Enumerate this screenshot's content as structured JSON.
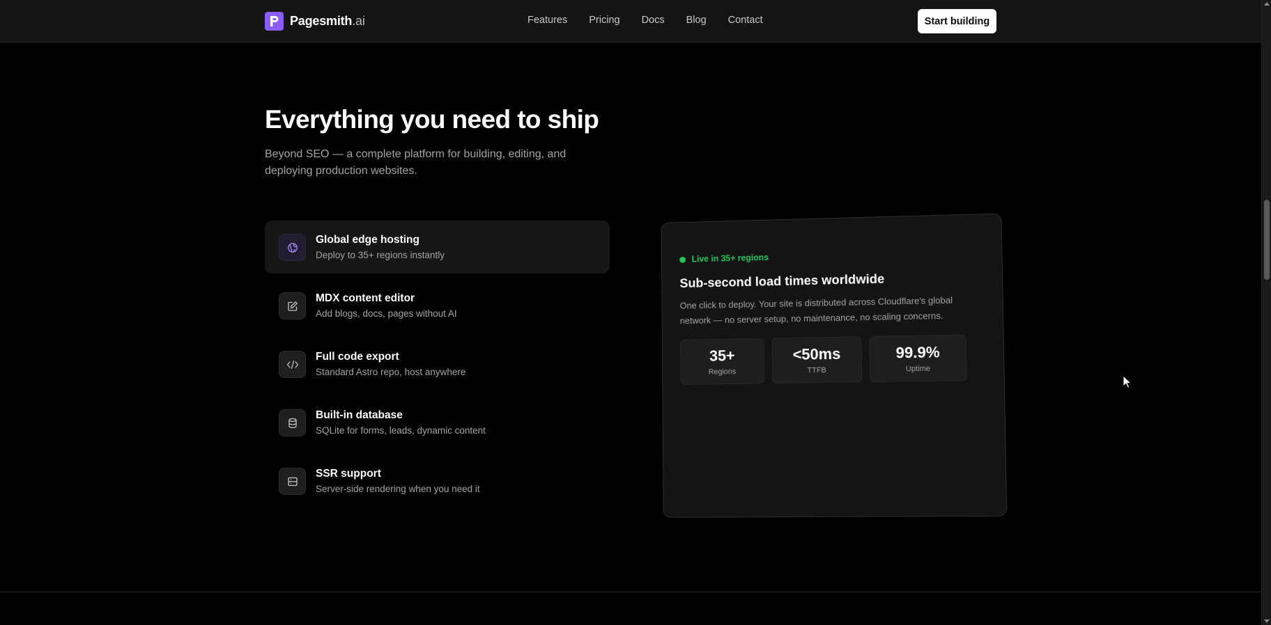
{
  "nav": {
    "brand_name": "Pagesmith",
    "brand_tld": ".ai",
    "links": [
      "Features",
      "Pricing",
      "Docs",
      "Blog",
      "Contact"
    ],
    "cta_label": "Start building"
  },
  "hero": {
    "title": "Everything you need to ship",
    "subtitle": "Beyond SEO — a complete platform for building, editing, and deploying production websites."
  },
  "features": [
    {
      "title": "Global edge hosting",
      "description": "Deploy to 35+ regions instantly",
      "icon": "globe-icon",
      "active": true
    },
    {
      "title": "MDX content editor",
      "description": "Add blogs, docs, pages without AI",
      "icon": "edit-icon",
      "active": false
    },
    {
      "title": "Full code export",
      "description": "Standard Astro repo, host anywhere",
      "icon": "code-icon",
      "active": false
    },
    {
      "title": "Built-in database",
      "description": "SQLite for forms, leads, dynamic content",
      "icon": "database-icon",
      "active": false
    },
    {
      "title": "SSR support",
      "description": "Server-side rendering when you need it",
      "icon": "server-icon",
      "active": false
    }
  ],
  "preview": {
    "badge": "Live in 35+ regions",
    "title": "Sub-second load times worldwide",
    "description": "One click to deploy. Your site is distributed across Cloudflare's global network — no server setup, no maintenance, no scaling concerns.",
    "stats": [
      {
        "value": "35+",
        "label": "Regions"
      },
      {
        "value": "<50ms",
        "label": "TTFB"
      },
      {
        "value": "99.9%",
        "label": "Uptime"
      }
    ]
  },
  "colors": {
    "accent": "#8b5cf6",
    "live_green": "#22c55e",
    "background": "#000000",
    "surface": "#141414"
  }
}
